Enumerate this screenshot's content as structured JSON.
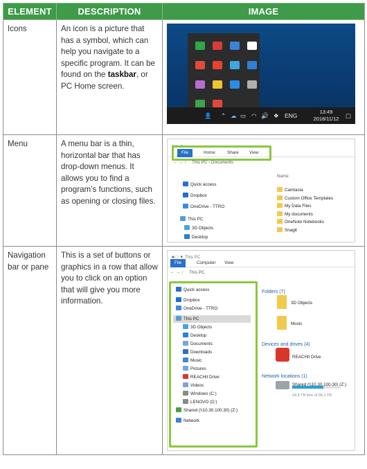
{
  "table": {
    "headers": [
      "ELEMENT",
      "DESCRIPTION",
      "IMAGE"
    ],
    "rows": [
      {
        "element": "Icons",
        "description_parts": [
          "An icon is a picture that has a symbol, which can help you navigate to a specific program. It can be found on the ",
          "taskbar",
          ", or PC Home screen."
        ]
      },
      {
        "element": "Menu",
        "description_parts": [
          "A menu bar is a thin, horizontal bar that has drop-down menus. It allows you to find a program’s functions, such as opening or closing files."
        ]
      },
      {
        "element": "Navigation bar or pane",
        "description_parts": [
          "This is a set of buttons or graphics in a row that allow you to click on an option that will give you more information."
        ]
      }
    ]
  },
  "taskbar_shot": {
    "lang": "ENG",
    "time": "13:49",
    "date": "2018/11/12",
    "icon_colors": [
      "#2ea84a",
      "#d93a3a",
      "#3b83d6",
      "#ffffff",
      "#e24b3b",
      "#e7432f",
      "#3fa7e0",
      "#2f7fd6",
      "#b86bd1",
      "#f0c330",
      "#2b8be8",
      "#b0b0b0",
      "#3fa34d",
      "#e2483a"
    ]
  },
  "menu_shot": {
    "tabs": [
      "File",
      "Home",
      "Share",
      "View"
    ],
    "breadcrumb": [
      "This PC",
      "Documents"
    ],
    "column_header": "Name",
    "nav_items": [
      "Quick access",
      "Dropbox",
      "OneDrive - TTRO",
      "This PC",
      "3D Objects",
      "Desktop"
    ],
    "files": [
      "Camtasia",
      "Custom Office Templates",
      "My Data Files",
      "My documents",
      "OneNote Notebooks",
      "Snagit"
    ]
  },
  "nav_shot": {
    "title": "This PC",
    "tabs": [
      "File",
      "Computer",
      "View"
    ],
    "breadcrumb": [
      "This PC"
    ],
    "nav_items": [
      "Quick access",
      "Dropbox",
      "OneDrive - TTRO",
      "This PC",
      "3D Objects",
      "Desktop",
      "Documents",
      "Downloads",
      "Music",
      "Pictures",
      "REACHit Drive",
      "Videos",
      "Windows (C:)",
      "LENOVO (D:)",
      "Shared (\\\\10.30.100.30) (Z:)",
      "Network"
    ],
    "groups": {
      "folders": "Folders (7)",
      "folder_items": [
        "3D Objects",
        "Music"
      ],
      "devices": "Devices and drives (4)",
      "device_items": [
        "REACHit Drive"
      ],
      "network": "Network locations (1)",
      "network_item": "Shared (\\\\10.30.100.30) (Z:)",
      "network_free": "34,8 TB free of 96,1 TB"
    }
  }
}
